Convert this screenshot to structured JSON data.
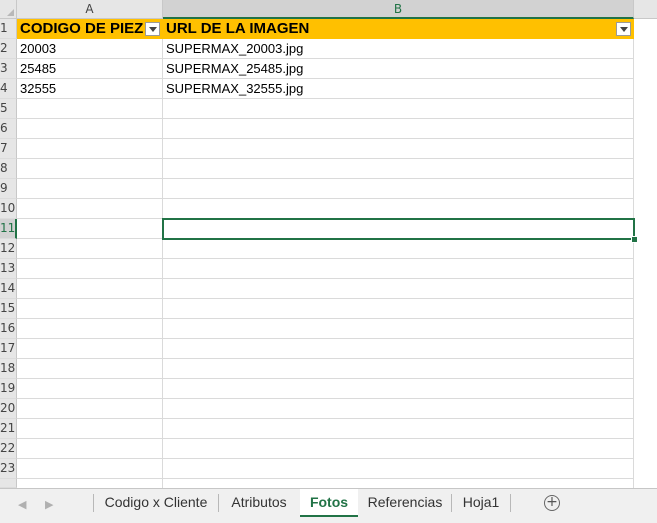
{
  "sheet": {
    "columns": [
      "A",
      "B"
    ],
    "selected_column": "B",
    "rows": [
      "1",
      "2",
      "3",
      "4",
      "5",
      "6",
      "7",
      "8",
      "9",
      "10",
      "11",
      "12",
      "13",
      "14",
      "15",
      "16",
      "17",
      "18",
      "19",
      "20",
      "21",
      "22",
      "23"
    ],
    "selected_row": "11",
    "header_row": [
      "CODIGO DE PIEZ",
      "URL DE LA IMAGEN"
    ],
    "data": [
      [
        "20003",
        "SUPERMAX_20003.jpg"
      ],
      [
        "25485",
        "SUPERMAX_25485.jpg"
      ],
      [
        "32555",
        "SUPERMAX_32555.jpg"
      ]
    ],
    "header_color": "#ffc000",
    "accent_color": "#217346"
  },
  "tabs": [
    {
      "label": "Codigo x Cliente",
      "active": false
    },
    {
      "label": "Atributos",
      "active": false
    },
    {
      "label": "Fotos",
      "active": true
    },
    {
      "label": "Referencias",
      "active": false
    },
    {
      "label": "Hoja1",
      "active": false
    }
  ],
  "nav": {
    "prev_arrow": "◀",
    "next_arrow": "▶",
    "add_sheet": "+"
  }
}
